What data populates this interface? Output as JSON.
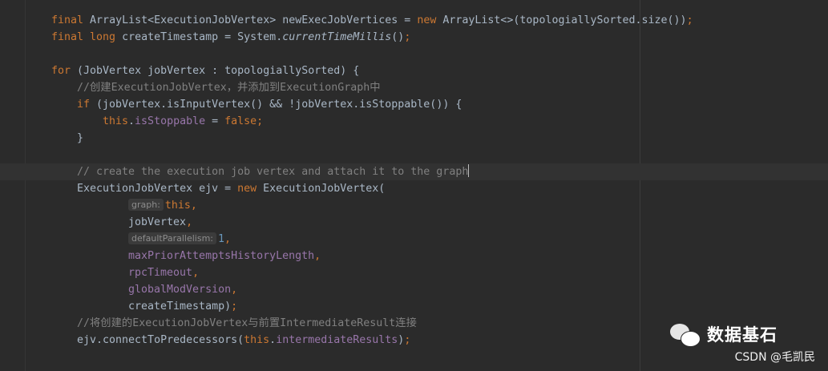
{
  "editor": {
    "lines": [
      {
        "indent": 1,
        "tokens": [
          {
            "t": "final ",
            "c": "kw"
          },
          {
            "t": "ArrayList<ExecutionJobVertex> newExecJobVertices = "
          },
          {
            "t": "new ",
            "c": "kw"
          },
          {
            "t": "ArrayList<>(topologiallySorted.size())"
          },
          {
            "t": ";",
            "c": "kw"
          }
        ]
      },
      {
        "indent": 1,
        "tokens": [
          {
            "t": "final long ",
            "c": "kw"
          },
          {
            "t": "createTimestamp = System."
          },
          {
            "t": "currentTimeMillis",
            "c": "it"
          },
          {
            "t": "()"
          },
          {
            "t": ";",
            "c": "kw"
          }
        ]
      },
      {
        "indent": 1,
        "tokens": []
      },
      {
        "indent": 1,
        "tokens": [
          {
            "t": "for ",
            "c": "kw"
          },
          {
            "t": "(JobVertex jobVertex : topologiallySorted) {"
          }
        ]
      },
      {
        "indent": 2,
        "tokens": [
          {
            "t": "//创建ExecutionJobVertex，并添加到ExecutionGraph中",
            "c": "cm"
          }
        ]
      },
      {
        "indent": 2,
        "tokens": [
          {
            "t": "if ",
            "c": "kw"
          },
          {
            "t": "(jobVertex.isInputVertex() && !jobVertex.isStoppable()) {"
          }
        ]
      },
      {
        "indent": 3,
        "tokens": [
          {
            "t": "this",
            "c": "kw"
          },
          {
            "t": "."
          },
          {
            "t": "isStoppable",
            "c": "fn"
          },
          {
            "t": " = "
          },
          {
            "t": "false;",
            "c": "kw"
          }
        ]
      },
      {
        "indent": 2,
        "tokens": [
          {
            "t": "}"
          }
        ]
      },
      {
        "indent": 2,
        "tokens": []
      },
      {
        "indent": 2,
        "current": true,
        "caret": true,
        "tokens": [
          {
            "t": "// create the execution job vertex and attach it to the graph",
            "c": "cm"
          }
        ]
      },
      {
        "indent": 2,
        "tokens": [
          {
            "t": "ExecutionJobVertex ejv = "
          },
          {
            "t": "new ",
            "c": "kw"
          },
          {
            "t": "ExecutionJobVertex("
          }
        ]
      },
      {
        "indent": 4,
        "tokens": [
          {
            "hint": "graph:"
          },
          {
            "t": "this,",
            "c": "kw"
          }
        ]
      },
      {
        "indent": 4,
        "tokens": [
          {
            "t": "jobVertex"
          },
          {
            "t": ",",
            "c": "kw"
          }
        ]
      },
      {
        "indent": 4,
        "tokens": [
          {
            "hint": "defaultParallelism:"
          },
          {
            "t": "1",
            "c": "num"
          },
          {
            "t": ",",
            "c": "kw"
          }
        ]
      },
      {
        "indent": 4,
        "tokens": [
          {
            "t": "maxPriorAttemptsHistoryLength",
            "c": "fn"
          },
          {
            "t": ",",
            "c": "kw"
          }
        ]
      },
      {
        "indent": 4,
        "tokens": [
          {
            "t": "rpcTimeout",
            "c": "fn"
          },
          {
            "t": ",",
            "c": "kw"
          }
        ]
      },
      {
        "indent": 4,
        "tokens": [
          {
            "t": "globalModVersion",
            "c": "fn"
          },
          {
            "t": ",",
            "c": "kw"
          }
        ]
      },
      {
        "indent": 4,
        "tokens": [
          {
            "t": "createTimestamp)"
          },
          {
            "t": ";",
            "c": "kw"
          }
        ]
      },
      {
        "indent": 2,
        "tokens": [
          {
            "t": "//将创建的ExecutionJobVertex与前置IntermediateResult连接",
            "c": "cm"
          }
        ]
      },
      {
        "indent": 2,
        "tokens": [
          {
            "t": "ejv.connectToPredecessors("
          },
          {
            "t": "this",
            "c": "kw"
          },
          {
            "t": "."
          },
          {
            "t": "intermediateResults",
            "c": "fn"
          },
          {
            "t": ")"
          },
          {
            "t": ";",
            "c": "kw"
          }
        ]
      }
    ]
  },
  "watermark": {
    "title": "数据基石",
    "subtitle": "CSDN @毛凯民"
  },
  "colors": {
    "background": "#2b2b2b",
    "current_line": "#323232",
    "keyword": "#cc7832",
    "field": "#9876aa",
    "number": "#6897bb",
    "comment": "#808080",
    "text": "#a9b7c6"
  }
}
